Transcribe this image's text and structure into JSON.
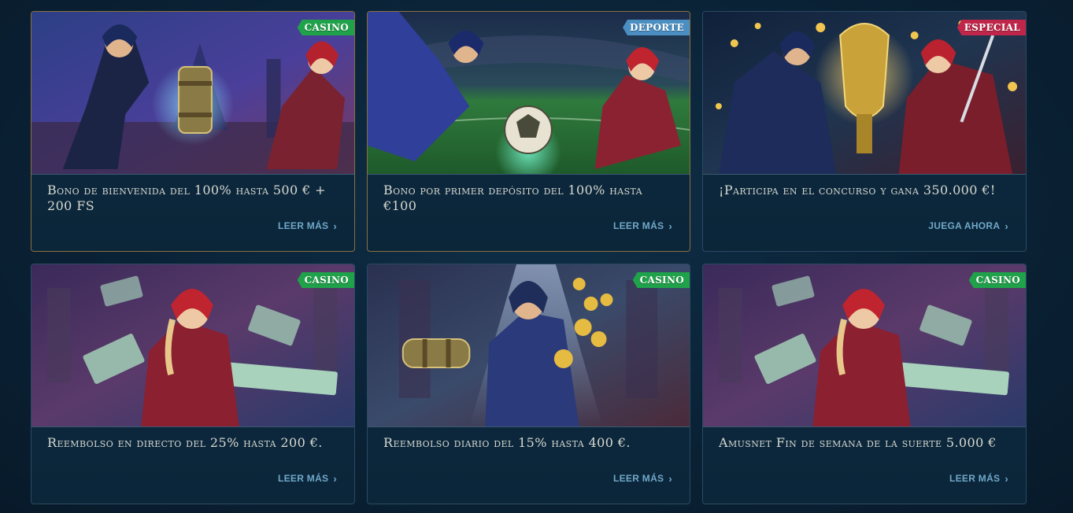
{
  "colors": {
    "casino_badge": "#1fa24a",
    "deporte_badge": "#4b8fc2",
    "especial_badge": "#c0264a",
    "link": "#6fa8c8",
    "title": "#d6d9d0",
    "card_border": "#2a4a62"
  },
  "cards": [
    {
      "badge": "CASINO",
      "badge_color": "#1fa24a",
      "title": "Bono de bienvenida del 100% hasta 500 € + 200 FS",
      "link": "LEER MÁS",
      "art": "two-heroes-with-cylinder-city-night",
      "highlight": true
    },
    {
      "badge": "DEPORTE",
      "badge_color": "#4b8fc2",
      "title": "Bono por primer depósito del 100% hasta €100",
      "link": "LEER MÁS",
      "art": "two-heroes-football-stadium",
      "highlight": true
    },
    {
      "badge": "ESPECIAL",
      "badge_color": "#c0264a",
      "title": "¡Participa en el concurso y gana 350.000 €!",
      "link": "JUEGA AHORA",
      "art": "two-heroes-trophy-coins",
      "highlight": false
    },
    {
      "badge": "CASINO",
      "badge_color": "#1fa24a",
      "title": "Reembolso en directo del 25% hasta 200 €.",
      "link": "LEER MÁS",
      "art": "red-hood-heroine-banknotes",
      "highlight": false
    },
    {
      "badge": "CASINO",
      "badge_color": "#1fa24a",
      "title": "Reembolso diario del 15% hasta 400 €.",
      "link": "LEER MÁS",
      "art": "hooded-hero-gold-coins",
      "highlight": false
    },
    {
      "badge": "CASINO",
      "badge_color": "#1fa24a",
      "title": "Amusnet Fin de semana de la suerte 5.000 €",
      "link": "LEER MÁS",
      "art": "red-hood-heroine-banknotes",
      "highlight": false
    }
  ]
}
